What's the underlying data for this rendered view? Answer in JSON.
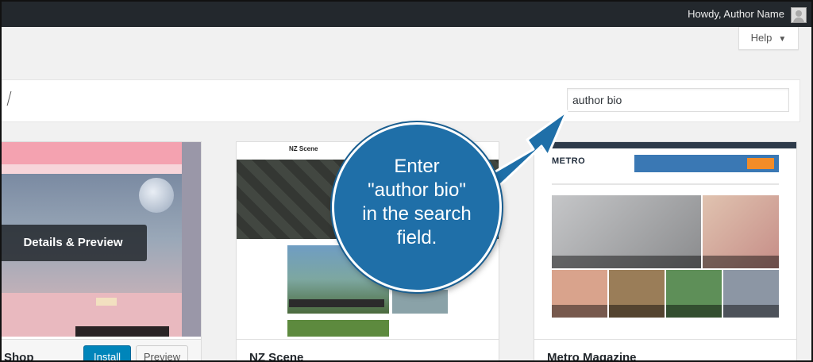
{
  "adminbar": {
    "greeting": "Howdy, Author Name"
  },
  "help": {
    "label": "Help"
  },
  "search": {
    "value": "author bio"
  },
  "themes": [
    {
      "name": "Shop",
      "overlay_label": "Details & Preview",
      "install_label": "Install",
      "preview_label": "Preview"
    },
    {
      "name": "NZ Scene",
      "screenshot_title": "NZ Scene"
    },
    {
      "name": "Metro Magazine",
      "screenshot_logo": "METRO"
    }
  ],
  "callout": {
    "lines": [
      "Enter",
      "\"author bio\"",
      "in the search",
      "field."
    ]
  },
  "colors": {
    "admin_bar": "#23282d",
    "primary_button": "#0085ba",
    "callout": "#1f6fa8"
  }
}
